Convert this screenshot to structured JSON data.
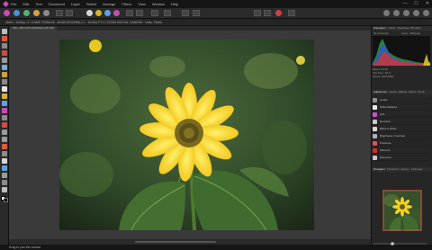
{
  "menubar": {
    "items": [
      "File",
      "Edit",
      "Text",
      "Document",
      "Layer",
      "Select",
      "Arrange",
      "Filters",
      "View",
      "Window",
      "Help"
    ],
    "window_controls": [
      "—",
      "☐",
      "✕"
    ]
  },
  "context": {
    "text": "4608 × 3336px, 3 / 5,5MP, RGBA/16 - sRGB IEC61966-2.1   ·   NOKIA PT1 2 ZOOM DIGITAL CAMERA   ·   Units: Pixels"
  },
  "document": {
    "tab_label": "IMG_0001.JPG (Modified) (25.3%)"
  },
  "status": {
    "text": "Drag to pan the canvas"
  },
  "panels": {
    "histogram_tabs": [
      "Histogram",
      "Colour",
      "Swatches",
      "Brushes"
    ],
    "histogram_meta": [
      "Mean: 90.45",
      "Std. Dev.: 52.4",
      "Pixels: 15372288"
    ],
    "histogram_controls": [
      "All Channels",
      "Layer",
      "Marquee"
    ],
    "adjustment_tabs": [
      "Adjustment",
      "Layers",
      "Effects",
      "Styles",
      "Stock"
    ],
    "adjustments": [
      {
        "label": "Levels",
        "color": "#8f8f8f"
      },
      {
        "label": "White Balance",
        "color": "#e8e8e8"
      },
      {
        "label": "HSL",
        "color": "#d04fd0"
      },
      {
        "label": "Recolour",
        "color": "#c8c8c8"
      },
      {
        "label": "Black & White",
        "color": "#d8d8d8"
      },
      {
        "label": "Brightness / Contrast",
        "color": "#b0b0b0"
      },
      {
        "label": "Posterise",
        "color": "#e05050"
      },
      {
        "label": "Vibrance",
        "color": "#d03030"
      },
      {
        "label": "Exposure",
        "color": "#c8c8c8"
      }
    ],
    "navigator_tabs": [
      "Navigator",
      "Transform",
      "History",
      "Channels"
    ]
  },
  "colors": {
    "accent": "#c94bb5",
    "photo_sky": "#2f4a25",
    "petal": "#f6d21a",
    "flower_center": "#7a6a1d"
  }
}
